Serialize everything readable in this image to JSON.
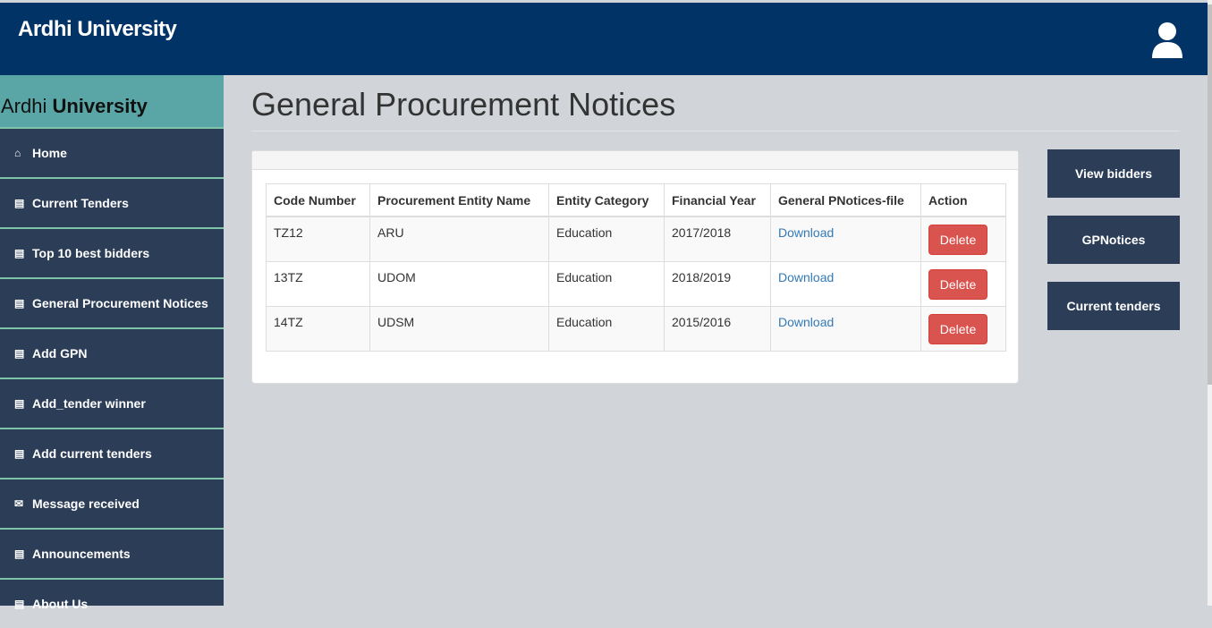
{
  "header": {
    "brand": "Ardhi University",
    "user_icon": "user-icon"
  },
  "sidebar": {
    "brand_light": "Ardhi",
    "brand_bold": "University",
    "items": [
      {
        "icon": "home-icon",
        "label": "Home"
      },
      {
        "icon": "bar-chart-icon",
        "label": "Current Tenders"
      },
      {
        "icon": "bar-chart-icon",
        "label": "Top 10 best bidders"
      },
      {
        "icon": "bar-chart-icon",
        "label": "General Procurement Notices"
      },
      {
        "icon": "bar-chart-icon",
        "label": "Add GPN"
      },
      {
        "icon": "bar-chart-icon",
        "label": "Add_tender winner"
      },
      {
        "icon": "bar-chart-icon",
        "label": "Add current tenders"
      },
      {
        "icon": "envelope-icon",
        "label": "Message received"
      },
      {
        "icon": "bar-chart-icon",
        "label": "Announcements"
      },
      {
        "icon": "bar-chart-icon",
        "label": "About Us"
      }
    ]
  },
  "main": {
    "title": "General Procurement Notices",
    "table": {
      "headers": [
        "Code Number",
        "Procurement Entity Name",
        "Entity Category",
        "Financial Year",
        "General PNotices-file",
        "Action"
      ],
      "rows": [
        {
          "code": "TZ12",
          "entity": "ARU",
          "category": "Education",
          "year": "2017/2018",
          "file": "Download",
          "action": "Delete"
        },
        {
          "code": "13TZ",
          "entity": "UDOM",
          "category": "Education",
          "year": "2018/2019",
          "file": "Download",
          "action": "Delete"
        },
        {
          "code": "14TZ",
          "entity": "UDSM",
          "category": "Education",
          "year": "2015/2016",
          "file": "Download",
          "action": "Delete"
        }
      ]
    }
  },
  "right_buttons": [
    "View bidders",
    "GPNotices",
    "Current tenders"
  ],
  "colors": {
    "header": "#023366",
    "sidebar": "#2c3e57",
    "sidebar_brand": "#5aa6a6",
    "danger": "#d9534f",
    "link": "#337ab7"
  }
}
